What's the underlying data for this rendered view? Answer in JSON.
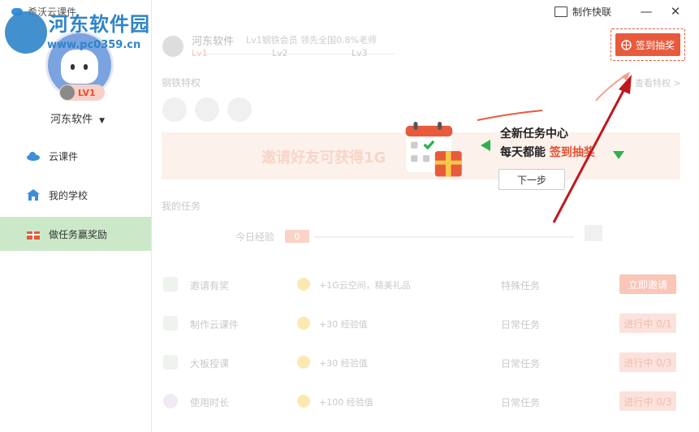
{
  "app": {
    "title": "希沃云课件",
    "watermark": "河东软件园",
    "watermark_url": "www.pc0359.cn"
  },
  "sidebar": {
    "level_badge": "LV1",
    "username": "河东软件",
    "items": [
      {
        "label": "云课件",
        "icon": "cloud-icon",
        "active": false
      },
      {
        "label": "我的学校",
        "icon": "school-icon",
        "active": false
      },
      {
        "label": "做任务赢奖励",
        "icon": "gift-icon",
        "active": true
      }
    ]
  },
  "header": {
    "make_quick": "制作快联",
    "minimize": "—",
    "close": "✕",
    "profile_name": "河东软件",
    "profile_desc": "Lv1钢铁会员 领先全国0.8%老师",
    "levels": [
      "Lv1",
      "Lv2",
      "Lv3"
    ],
    "sign_button": "签到抽奖"
  },
  "privilege": {
    "title": "钢铁特权",
    "link": "查看特权 >"
  },
  "banner": {
    "text": "邀请好友可获得1G"
  },
  "tasks": {
    "title": "我的任务",
    "today_exp_label": "今日经验",
    "today_exp_value": "0",
    "rows": [
      {
        "name": "邀请有奖",
        "reward": "+1G云空间，精美礼品",
        "type": "特殊任务",
        "action": "立即邀请"
      },
      {
        "name": "制作云课件",
        "reward": "+30 经验值",
        "type": "日常任务",
        "action": "进行中 0/1"
      },
      {
        "name": "大板授课",
        "reward": "+30 经验值",
        "type": "日常任务",
        "action": "进行中 0/3"
      },
      {
        "name": "使用时长",
        "reward": "+100 经验值",
        "type": "日常任务",
        "action": "进行中 0/3"
      }
    ]
  },
  "tooltip": {
    "title": "全新任务中心",
    "sub_prefix": "每天都能",
    "sub_highlight": "签到抽奖",
    "next": "下一步"
  },
  "colors": {
    "accent": "#e85a3c",
    "nav_active": "#cbe9c9",
    "watermark": "#2f84c9",
    "arrow": "#c0171e"
  }
}
